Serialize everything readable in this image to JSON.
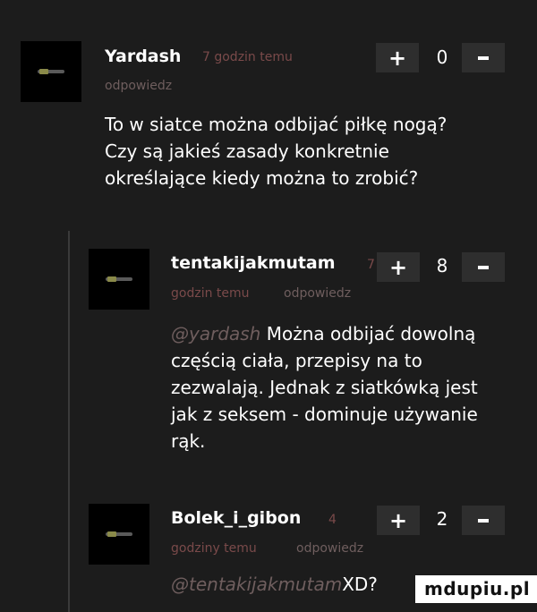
{
  "comments": [
    {
      "user": "Yardash",
      "time": "7 godzin temu",
      "reply": "odpowiedz",
      "score": "0",
      "mention": "",
      "text_lines": [
        "To w siatce można odbijać piłkę nogą?",
        "Czy są jakieś zasady konkretnie",
        "określające kiedy można to zrobić?"
      ]
    },
    {
      "user": "tentakijakmutam",
      "time_fragment": "7",
      "time_rest": "godzin temu",
      "reply": "odpowiedz",
      "score": "8",
      "mention": "@yardash",
      "text_first": "Można odbijać dowolną",
      "text_lines": [
        "częścią ciała, przepisy na to",
        "zezwalają. Jednak z siatkówką jest",
        "jak z seksem - dominuje używanie",
        "rąk."
      ]
    },
    {
      "user": "Bolek_i_gibon",
      "time_fragment": "4",
      "time_rest": "godziny temu",
      "reply": "odpowiedz",
      "score": "2",
      "mention": "@tentakijakmutam",
      "text_first": "XD?"
    }
  ],
  "vote": {
    "plus": "+"
  },
  "watermark": "mdupiu.pl"
}
